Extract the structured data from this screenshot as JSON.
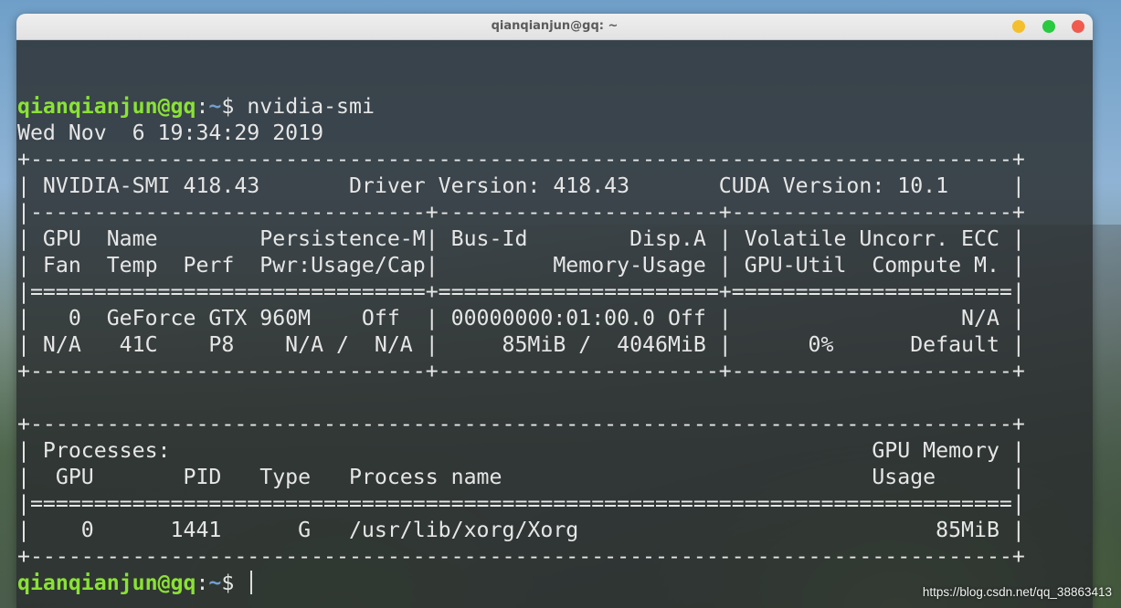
{
  "window": {
    "title": "qianqianjun@gq: ~"
  },
  "terminal": {
    "prompt1": {
      "user_host": "qianqianjun@gq",
      "sep": ":",
      "path": "~",
      "symbol": "$ ",
      "command": "nvidia-smi"
    },
    "lines": [
      "Wed Nov  6 19:34:29 2019",
      "+-----------------------------------------------------------------------------+",
      "| NVIDIA-SMI 418.43       Driver Version: 418.43       CUDA Version: 10.1     |",
      "|-------------------------------+----------------------+----------------------+",
      "| GPU  Name        Persistence-M| Bus-Id        Disp.A | Volatile Uncorr. ECC |",
      "| Fan  Temp  Perf  Pwr:Usage/Cap|         Memory-Usage | GPU-Util  Compute M. |",
      "|===============================+======================+======================|",
      "|   0  GeForce GTX 960M    Off  | 00000000:01:00.0 Off |                  N/A |",
      "| N/A   41C    P8    N/A /  N/A |     85MiB /  4046MiB |      0%      Default |",
      "+-------------------------------+----------------------+----------------------+",
      "",
      "+-----------------------------------------------------------------------------+",
      "| Processes:                                                       GPU Memory |",
      "|  GPU       PID   Type   Process name                             Usage      |",
      "|=============================================================================|",
      "|    0      1441      G   /usr/lib/xorg/Xorg                            85MiB |",
      "+-----------------------------------------------------------------------------+"
    ],
    "prompt2": {
      "user_host": "qianqianjun@gq",
      "sep": ":",
      "path": "~",
      "symbol": "$ "
    }
  },
  "watermark": "https://blog.csdn.net/qq_38863413",
  "colors": {
    "prompt_user": "#8ae234",
    "prompt_path": "#729fcf",
    "text": "#e6e6e6",
    "close": "#f05a4f",
    "minimize": "#f4bf2e",
    "maximize": "#29c940"
  }
}
